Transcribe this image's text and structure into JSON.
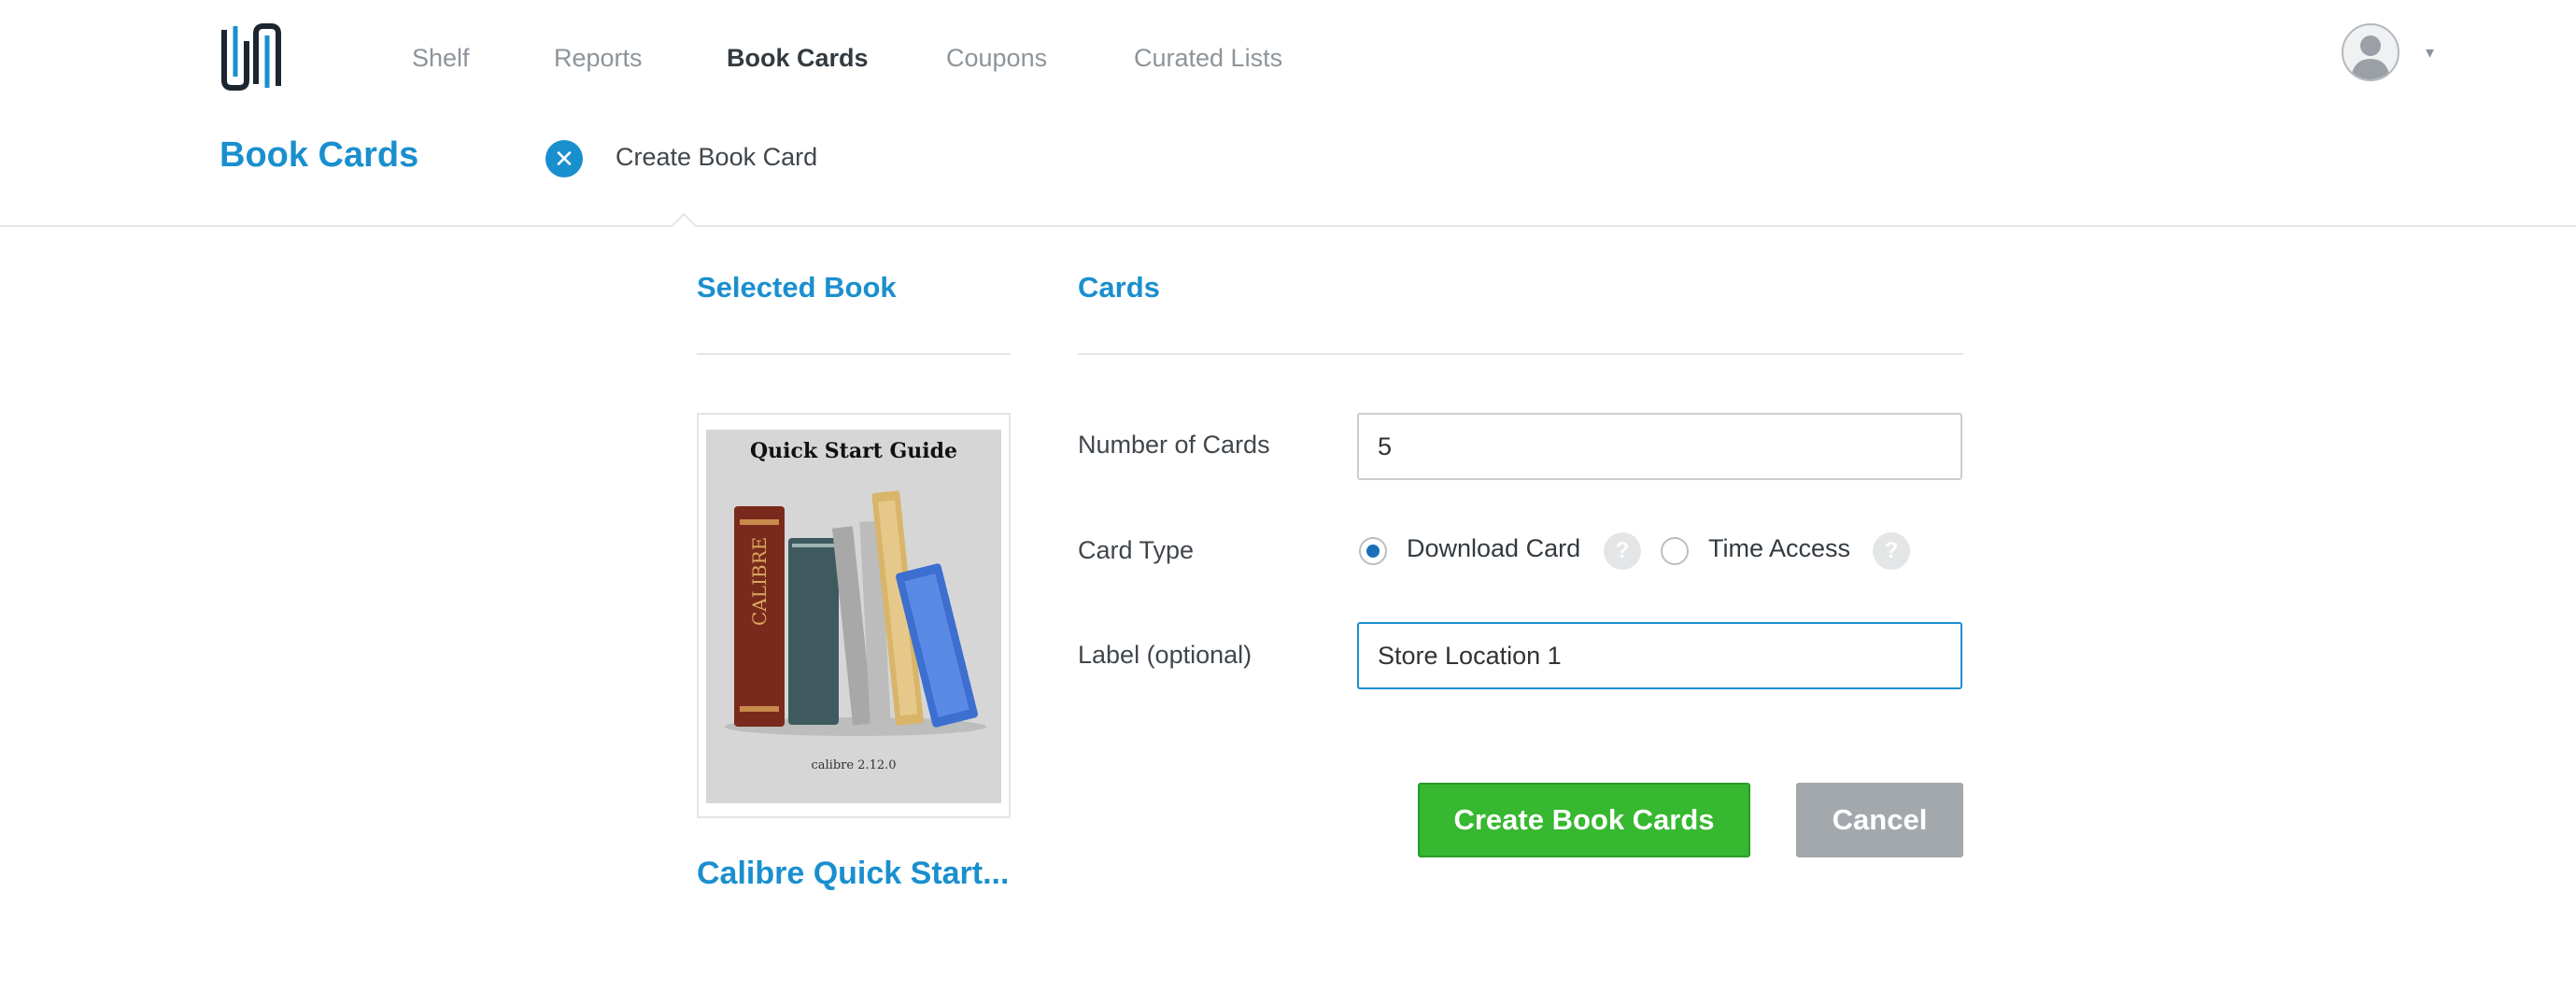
{
  "nav": {
    "items": [
      {
        "label": "Shelf",
        "active": false
      },
      {
        "label": "Reports",
        "active": false
      },
      {
        "label": "Book Cards",
        "active": true
      },
      {
        "label": "Coupons",
        "active": false
      },
      {
        "label": "Curated Lists",
        "active": false
      }
    ],
    "logo_icon": "paperclip-logo-icon",
    "avatar_icon": "user-avatar-icon",
    "caret": "▾"
  },
  "subheader": {
    "title": "Book Cards",
    "close_glyph": "✕",
    "crumb": "Create Book Card"
  },
  "sections": {
    "selected_book": "Selected Book",
    "cards": "Cards"
  },
  "book": {
    "cover_title": "Quick Start Guide",
    "spine_text": "CALIBRE",
    "cover_footer": "calibre 2.12.0",
    "name": "Calibre Quick Start..."
  },
  "form": {
    "num_cards_label": "Number of Cards",
    "num_cards_value": "5",
    "card_type_label": "Card Type",
    "card_type_options": [
      "Download Card",
      "Time Access"
    ],
    "card_type_selected": "Download Card",
    "help_glyph": "?",
    "label_label": "Label (optional)",
    "label_value": "Store Location 1"
  },
  "buttons": {
    "create": "Create Book Cards",
    "cancel": "Cancel"
  },
  "colors": {
    "accent": "#1a8fce",
    "create_button": "#36b830",
    "cancel_button": "#a3a8ac"
  }
}
